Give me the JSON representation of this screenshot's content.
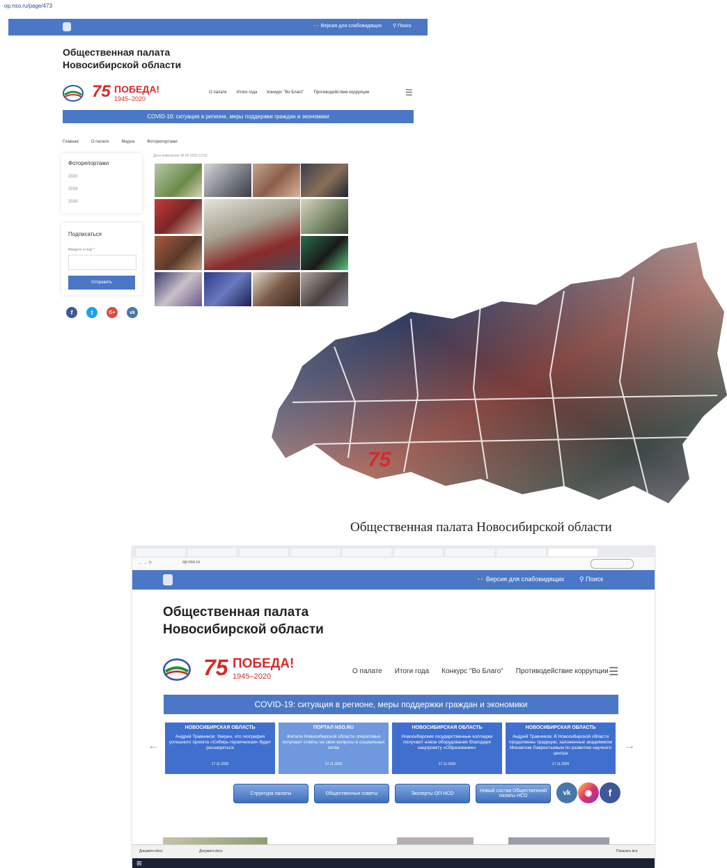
{
  "top_shot": {
    "url": "op.nso.ru/page/473",
    "accessibility": "Версия для слабовидящих",
    "search": "Поиск",
    "site_title": "Общественная палата Новосибирской области",
    "pobeda": {
      "num": "75",
      "word": "ПОБЕДА!",
      "years": "1945–2020"
    },
    "nav": [
      "О палате",
      "Итоги года",
      "Конкурс \"Во Благо\"",
      "Противодействие коррупции"
    ],
    "covid": "COVID-19: ситуация в регионе, меры поддержки граждан и экономики",
    "breadcrumb": [
      "Главная",
      "О палате",
      "Медиа",
      "Фоторепортажи"
    ],
    "date": "Дата изменения 08.04.2020 12:52",
    "sidebar": {
      "heading": "Фоторепортажи",
      "years": [
        "2020",
        "2019",
        "2018"
      ]
    },
    "subscribe": {
      "heading": "Подписаться",
      "label": "Введите e-mail *",
      "button": "Отправить"
    }
  },
  "caption": "Общественная палата Новосибирской области",
  "bottom_shot": {
    "address": "op.nso.ru",
    "accessibility": "Версия для слабовидящих",
    "search": "Поиск",
    "site_title": "Общественная палата Новосибирской области",
    "pobeda": {
      "num": "75",
      "word": "ПОБЕДА!",
      "years": "1945–2020"
    },
    "nav": [
      "О палате",
      "Итоги года",
      "Конкурс \"Во Благо\"",
      "Противодействие коррупции"
    ],
    "covid": "COVID-19: ситуация в регионе, меры поддержки граждан и экономики",
    "news": [
      {
        "tag": "НОВОСИБИРСКАЯ ОБЛАСТЬ",
        "text": "Андрей Травников: Уверен, что география успешного проекта «Сибирь героическая» будет расширяться",
        "date": "17.11.2020",
        "color": "#3f6fcf"
      },
      {
        "tag": "ПОРТАЛ NSO.RU",
        "text": "Жители Новосибирской области оперативно получают ответы на свои вопросы в социальных сетях",
        "date": "17.11.2020",
        "color": "#6f98df"
      },
      {
        "tag": "НОВОСИБИРСКАЯ ОБЛАСТЬ",
        "text": "Новосибирские государственные колледжи получают новое оборудование благодаря нацпроекту «Образование»",
        "date": "17.11.2020",
        "color": "#3f6fcf"
      },
      {
        "tag": "НОВОСИБИРСКАЯ ОБЛАСТЬ",
        "text": "Андрей Травников: В Новосибирской области продолжены традиции, заложенные академиком Михаилом Лаврентьевым по развитию научного центра",
        "date": "17.11.2020",
        "color": "#3f6fcf"
      }
    ],
    "buttons": [
      "Структура палаты",
      "Общественные советы",
      "Эксперты ОП НСО",
      "Новый состав Общественной палаты НСО"
    ],
    "downloads": [
      "Документ.docx",
      "Документ.docx"
    ],
    "show_all": "Показать все"
  },
  "colors": {
    "brand_blue": "#4a78c6",
    "pobeda_red": "#d62b2b"
  }
}
